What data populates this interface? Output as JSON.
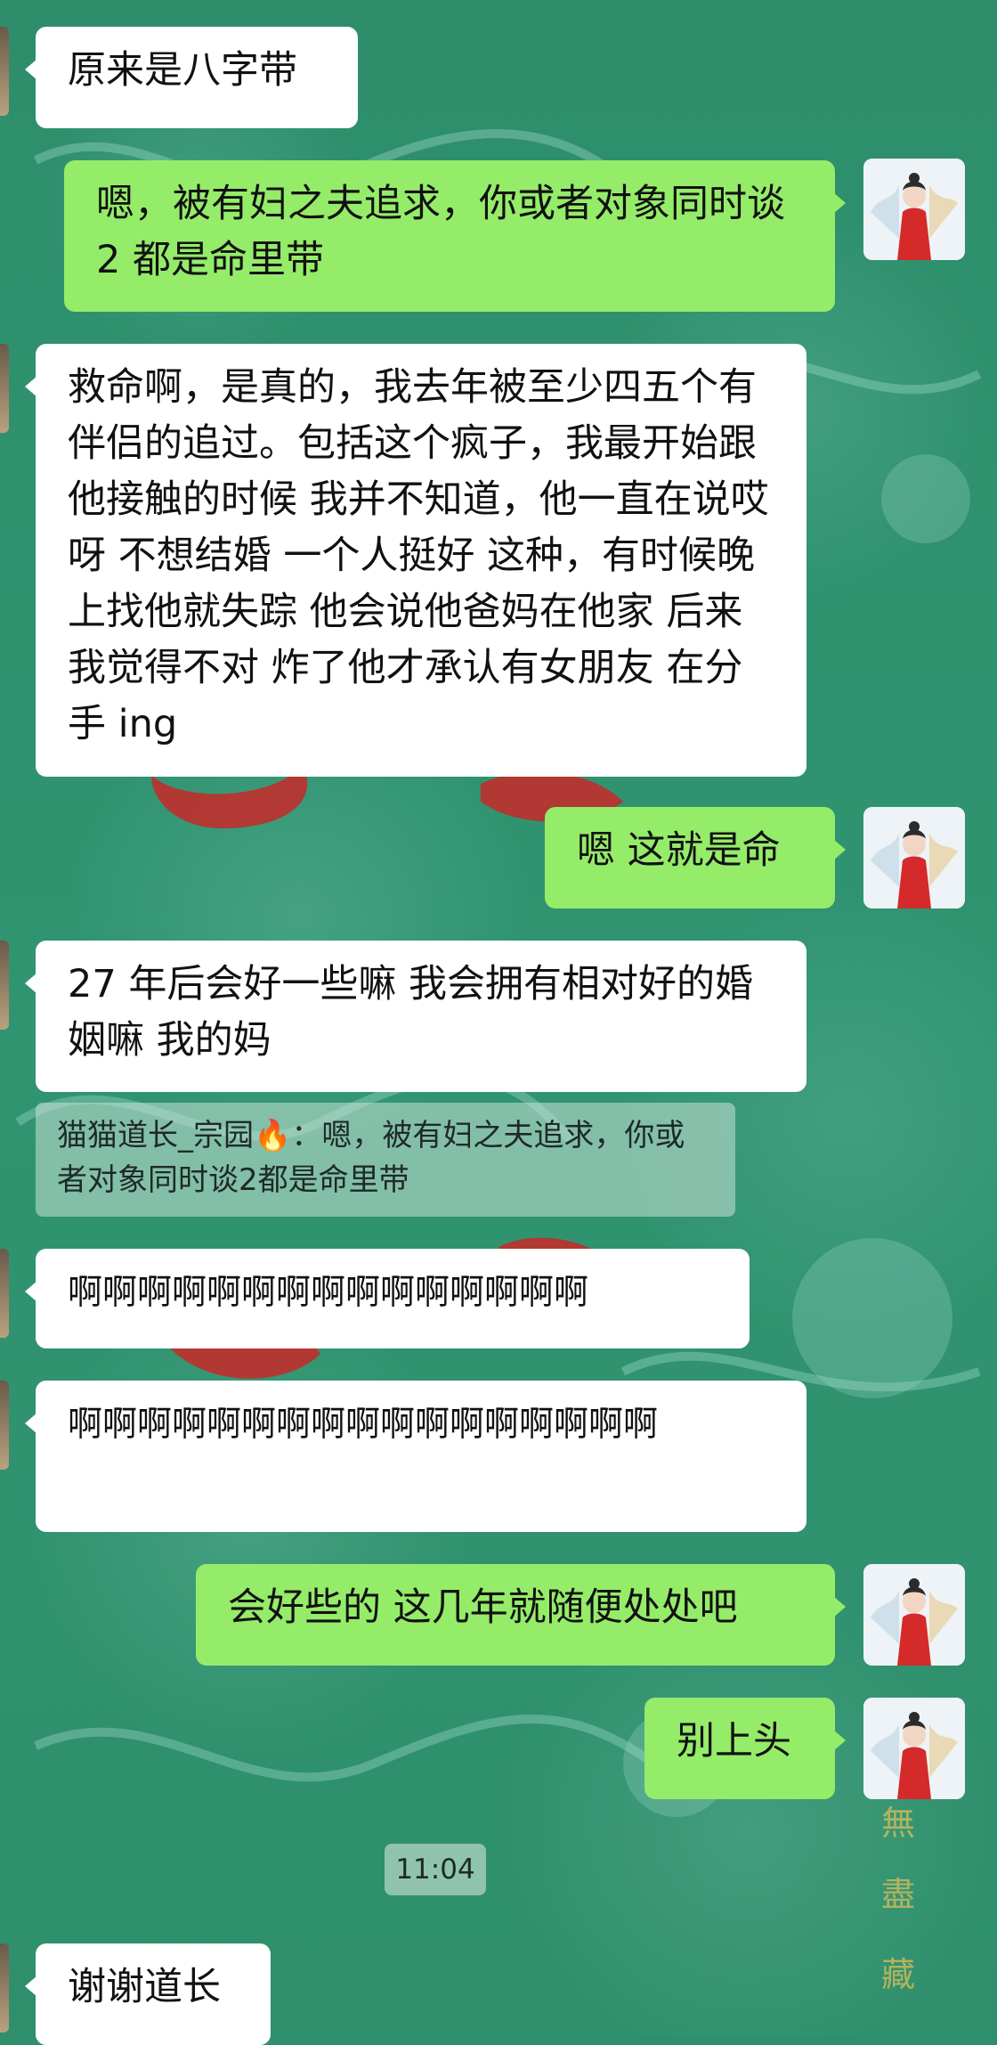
{
  "messages": [
    {
      "text": "原来是八字带"
    },
    {
      "text": "嗯，被有妇之夫追求，你或者对象同时谈 2 都是命里带"
    },
    {
      "text": "救命啊，是真的，我去年被至少四五个有伴侣的追过。包括这个疯子，我最开始跟他接触的时候 我并不知道，他一直在说哎呀 不想结婚 一个人挺好 这种，有时候晚上找他就失踪 他会说他爸妈在他家 后来我觉得不对 炸了他才承认有女朋友 在分手 ing"
    },
    {
      "text": "嗯 这就是命"
    },
    {
      "text": "27 年后会好一些嘛 我会拥有相对好的婚姻嘛 我的妈"
    },
    {
      "text": "啊啊啊啊啊啊啊啊啊啊啊啊啊啊啊"
    },
    {
      "text": "啊啊啊啊啊啊啊啊啊啊啊啊啊啊啊啊啊"
    },
    {
      "text": "会好些的 这几年就随便处处吧"
    },
    {
      "text": "别上头"
    },
    {
      "text": "谢谢道长"
    }
  ],
  "quote": {
    "text": "猫猫道长_宗园🔥：嗯，被有妇之夫追求，你或者对象同时谈2都是命里带"
  },
  "timestamp": "11:04",
  "colors": {
    "incoming_bubble": "#ffffff",
    "outgoing_bubble": "#95ec69",
    "background": "#2f8f6c"
  },
  "icons": {
    "avatar": "avatar-icon"
  }
}
